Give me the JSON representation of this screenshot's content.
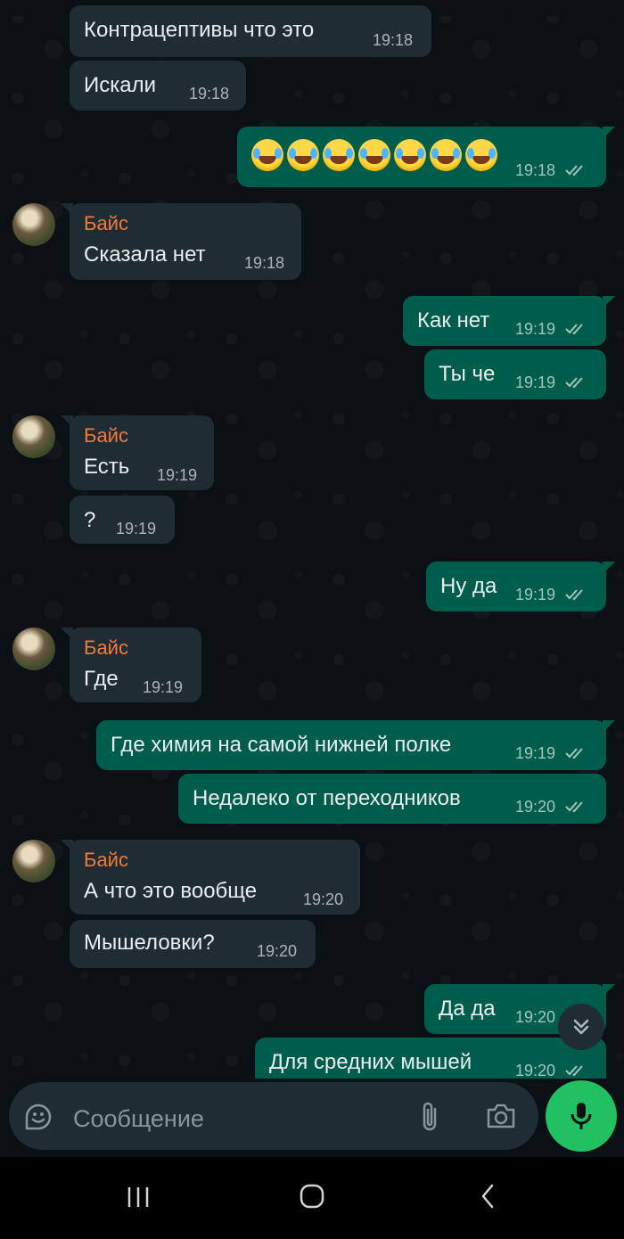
{
  "messages": [
    {
      "text": "Контрацептивы что это",
      "time": "19:18"
    },
    {
      "text": "Искали",
      "time": "19:18"
    },
    {
      "text": "",
      "time": "19:18",
      "emoji_count": 7,
      "emoji_name": "rolling-on-floor-laughing"
    },
    {
      "sender": "Байс",
      "text": "Сказала нет",
      "time": "19:18"
    },
    {
      "text": "Как нет",
      "time": "19:19"
    },
    {
      "text": "Ты че",
      "time": "19:19"
    },
    {
      "sender": "Байс",
      "text": "Есть",
      "time": "19:19"
    },
    {
      "text": "?",
      "time": "19:19"
    },
    {
      "text": "Ну да",
      "time": "19:19"
    },
    {
      "sender": "Байс",
      "text": "Где",
      "time": "19:19"
    },
    {
      "text": "Где химия на самой нижней полке",
      "time": "19:19"
    },
    {
      "text": "Недалеко от переходников",
      "time": "19:20"
    },
    {
      "sender": "Байс",
      "text": "А что это вообще",
      "time": "19:20"
    },
    {
      "text": "Мышеловки?",
      "time": "19:20"
    },
    {
      "text": "Да да",
      "time": "19:20"
    },
    {
      "text": "Для средних мышей",
      "time": "19:20"
    }
  ],
  "composer": {
    "placeholder": "Сообщение",
    "icons": [
      "sticker-icon",
      "attach-icon",
      "camera-icon",
      "mic-icon"
    ]
  },
  "navbar": {
    "icons": [
      "recents-icon",
      "home-icon",
      "back-icon"
    ]
  },
  "colors": {
    "background": "#0b1014",
    "incoming_bubble": "#202c33",
    "outgoing_bubble": "#005c4b",
    "sender_name": "#f07a3a",
    "accent": "#21c063",
    "read_ticks": "#9fc7bd"
  }
}
